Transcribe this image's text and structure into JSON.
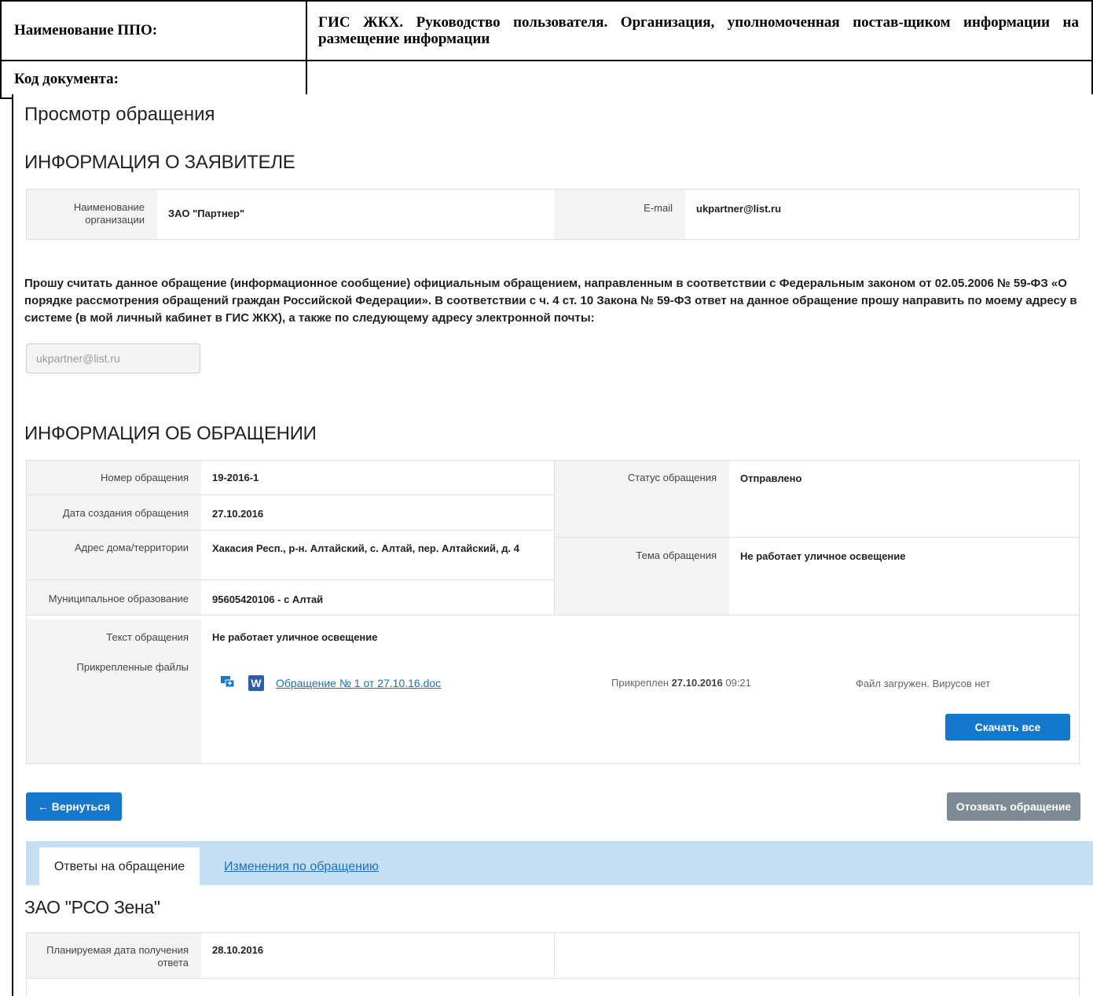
{
  "doc_header": {
    "ppo_label": "Наименование ППО:",
    "ppo_value": "ГИС ЖКХ. Руководство пользователя. Организация, уполномоченная постав-щиком информации на размещение информации",
    "code_label": "Код документа:",
    "code_value": ""
  },
  "page": {
    "title": "Просмотр обращения"
  },
  "applicant": {
    "section_title": "ИНФОРМАЦИЯ О ЗАЯВИТЕЛЕ",
    "org_label": "Наименование организации",
    "org_value": "ЗАО \"Партнер\"",
    "email_label": "E-mail",
    "email_value": "ukpartner@list.ru"
  },
  "request_text": "Прошу считать данное обращение (информационное сообщение) официальным обращением, направленным в соответствии с Федеральным законом от 02.05.2006 № 59-ФЗ «О порядке рассмотрения обращений граждан Российской Федерации». В соответствии с ч. 4 ст. 10 Закона № 59-ФЗ ответ на данное обращение прошу направить по моему адресу в системе (в мой личный кабинет в ГИС ЖКХ), а также по следующему адресу электронной почты:",
  "reply_email": {
    "value": "ukpartner@list.ru"
  },
  "appeal": {
    "section_title": "ИНФОРМАЦИЯ ОБ ОБРАЩЕНИИ",
    "number_label": "Номер обращения",
    "number_value": "19-2016-1",
    "date_label": "Дата создания обращения",
    "date_value": "27.10.2016",
    "address_label": "Адрес дома/территории",
    "address_value": "Хакасия Респ., р-н. Алтайский, с. Алтай, пер. Алтайский, д. 4",
    "municipal_label": "Муниципальное образование",
    "municipal_value": "95605420106 - с Алтай",
    "status_label": "Статус обращения",
    "status_value": "Отправлено",
    "topic_label": "Тема обращения",
    "topic_value": "Не работает уличное освещение",
    "text_label": "Текст обращения",
    "text_value": "Не работает уличное освещение",
    "files_label": "Прикрепленные файлы",
    "file": {
      "name": "Обращение № 1 от 27.10.16.doc",
      "attached_prefix": "Прикреплен",
      "attached_date": "27.10.2016",
      "attached_time": "09:21",
      "scan_status": "Файл загружен. Вирусов нет",
      "word_icon_letter": "W"
    },
    "download_all": "Скачать все"
  },
  "actions": {
    "back": "← Вернуться",
    "withdraw": "Отозвать обращение"
  },
  "tabs": {
    "answers": "Ответы на обращение",
    "changes": "Изменения по обращению"
  },
  "response": {
    "org_title": "ЗАО \"РСО Зена\"",
    "planned_label": "Планируемая дата получения ответа",
    "planned_value": "28.10.2016"
  },
  "colors": {
    "primary_button": "#1479cc",
    "secondary_button": "#7c8a96",
    "tabs_bar": "#c4dff3",
    "link": "#1e6fbf",
    "label_bg": "#f3f3f3"
  }
}
